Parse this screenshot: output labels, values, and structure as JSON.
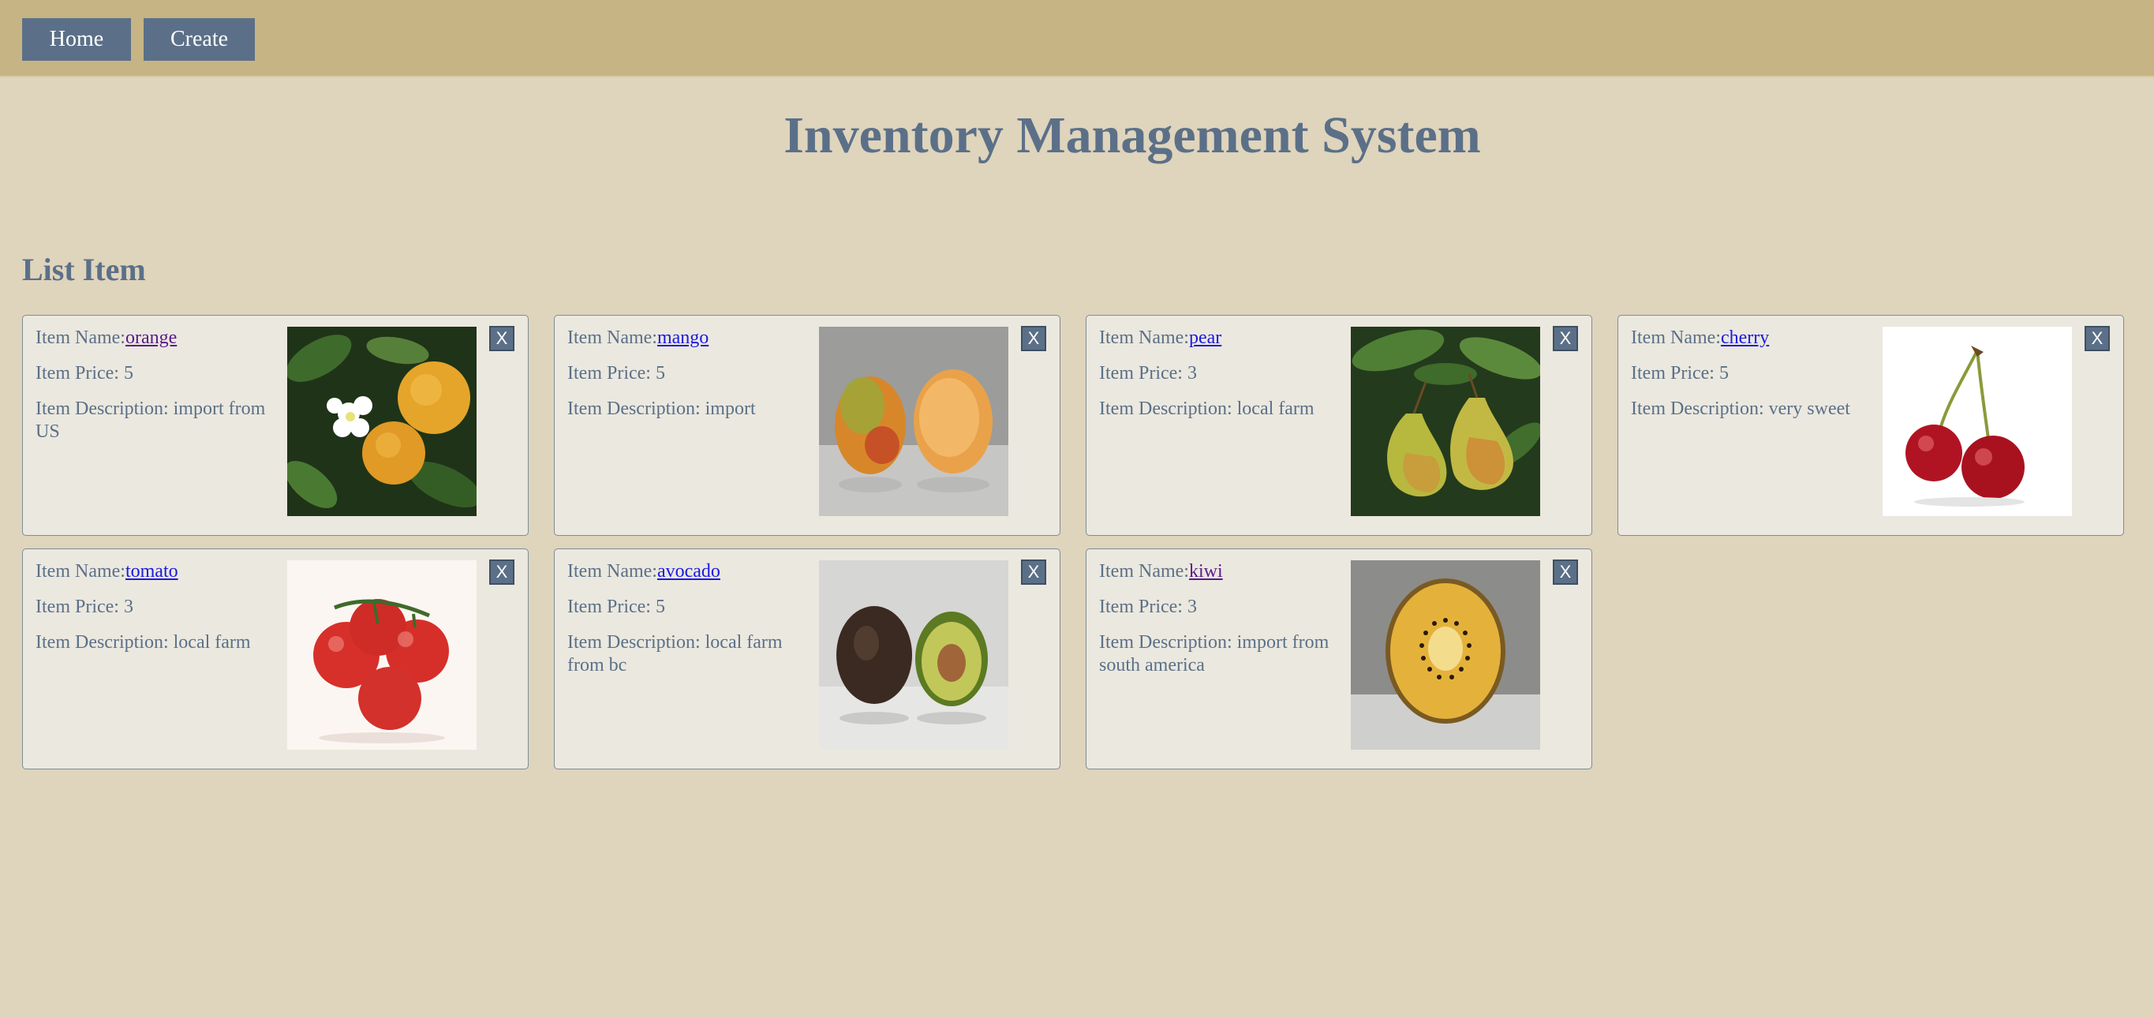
{
  "nav": {
    "home_label": "Home",
    "create_label": "Create"
  },
  "page_title": "Inventory Management System",
  "section_title": "List Item",
  "labels": {
    "name": "Item Name:",
    "price": "Item Price: ",
    "description": "Item Description: ",
    "delete": "X"
  },
  "items": [
    {
      "name": "orange",
      "price": "5",
      "description": "import from US",
      "image": "orange-photo"
    },
    {
      "name": "mango",
      "price": "5",
      "description": "import",
      "image": "mango-photo"
    },
    {
      "name": "pear",
      "price": "3",
      "description": "local farm",
      "image": "pear-photo"
    },
    {
      "name": "cherry",
      "price": "5",
      "description": "very sweet",
      "image": "cherry-photo"
    },
    {
      "name": "tomato",
      "price": "3",
      "description": "local farm",
      "image": "tomato-photo"
    },
    {
      "name": "avocado",
      "price": "5",
      "description": "local farm from bc",
      "image": "avocado-photo"
    },
    {
      "name": "kiwi",
      "price": "3",
      "description": "import from south america",
      "image": "kiwi-photo"
    }
  ],
  "colors": {
    "navbar": "#c7b484",
    "background": "#dfd4bc",
    "accent": "#5b7088",
    "card": "#ebe8df",
    "link": "#1a1ae0",
    "visited_link": "#5a1a8a"
  }
}
